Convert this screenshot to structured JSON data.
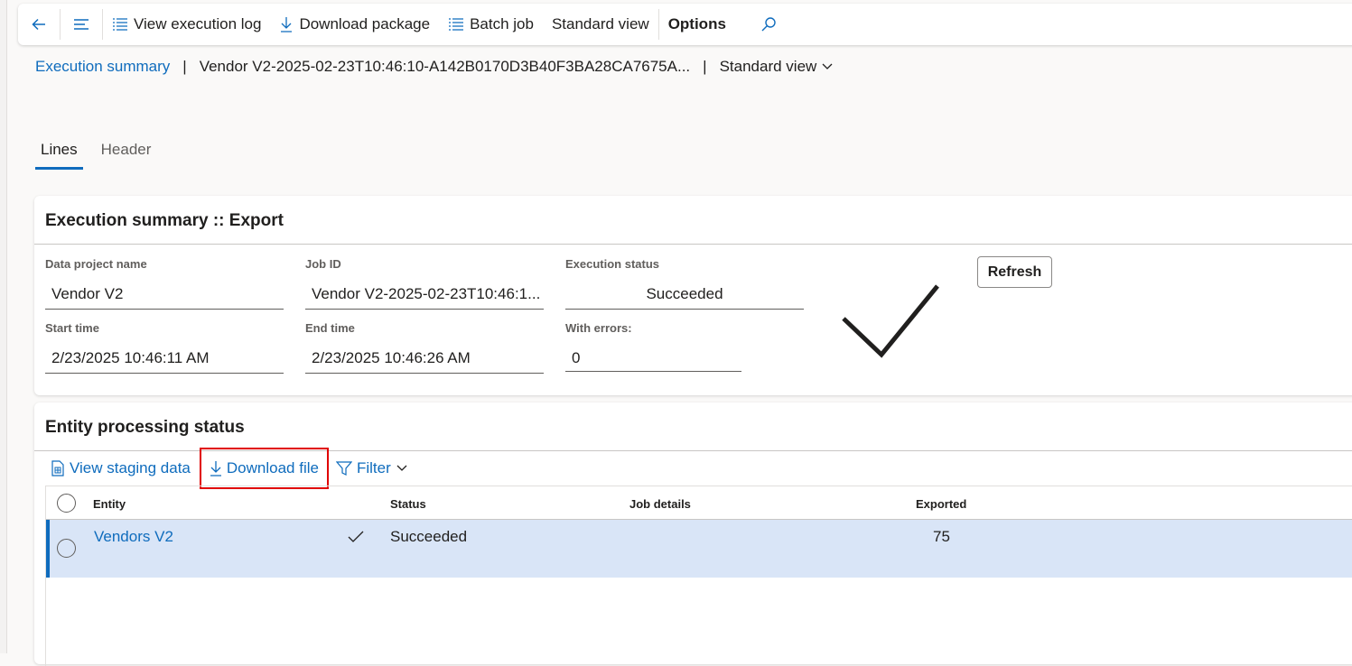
{
  "action_pane": {
    "view_execution_log": "View execution log",
    "download_package": "Download package",
    "batch_job": "Batch job",
    "standard_view": "Standard view",
    "options": "Options"
  },
  "breadcrumb": {
    "link": "Execution summary",
    "record": "Vendor V2-2025-02-23T10:46:10-A142B0170D3B40F3BA28CA7675A...",
    "view": "Standard view",
    "separator": "|"
  },
  "tabs": [
    {
      "label": "Lines",
      "active": true
    },
    {
      "label": "Header",
      "active": false
    }
  ],
  "summary": {
    "title": "Execution summary :: Export",
    "data_project_name": {
      "label": "Data project name",
      "value": "Vendor V2"
    },
    "job_id": {
      "label": "Job ID",
      "value": "Vendor V2-2025-02-23T10:46:1..."
    },
    "execution_status": {
      "label": "Execution status",
      "value": "Succeeded"
    },
    "start_time": {
      "label": "Start time",
      "value": "2/23/2025 10:46:11 AM"
    },
    "end_time": {
      "label": "End time",
      "value": "2/23/2025 10:46:26 AM"
    },
    "with_errors": {
      "label": "With errors:",
      "value": "0"
    },
    "refresh": "Refresh",
    "status_icon": "checkmark-icon"
  },
  "entity_status": {
    "title": "Entity processing status",
    "toolbar": {
      "view_staging_data": "View staging data",
      "download_file": "Download file",
      "filter": "Filter"
    },
    "columns": {
      "entity": "Entity",
      "status": "Status",
      "job_details": "Job details",
      "exported": "Exported"
    },
    "rows": [
      {
        "entity": "Vendors V2",
        "status": "Succeeded",
        "job_details": "",
        "exported": "75"
      }
    ]
  },
  "colors": {
    "accent": "#0f6cbd",
    "selected_row": "#d9e5f7",
    "highlight_border": "#e00000"
  }
}
